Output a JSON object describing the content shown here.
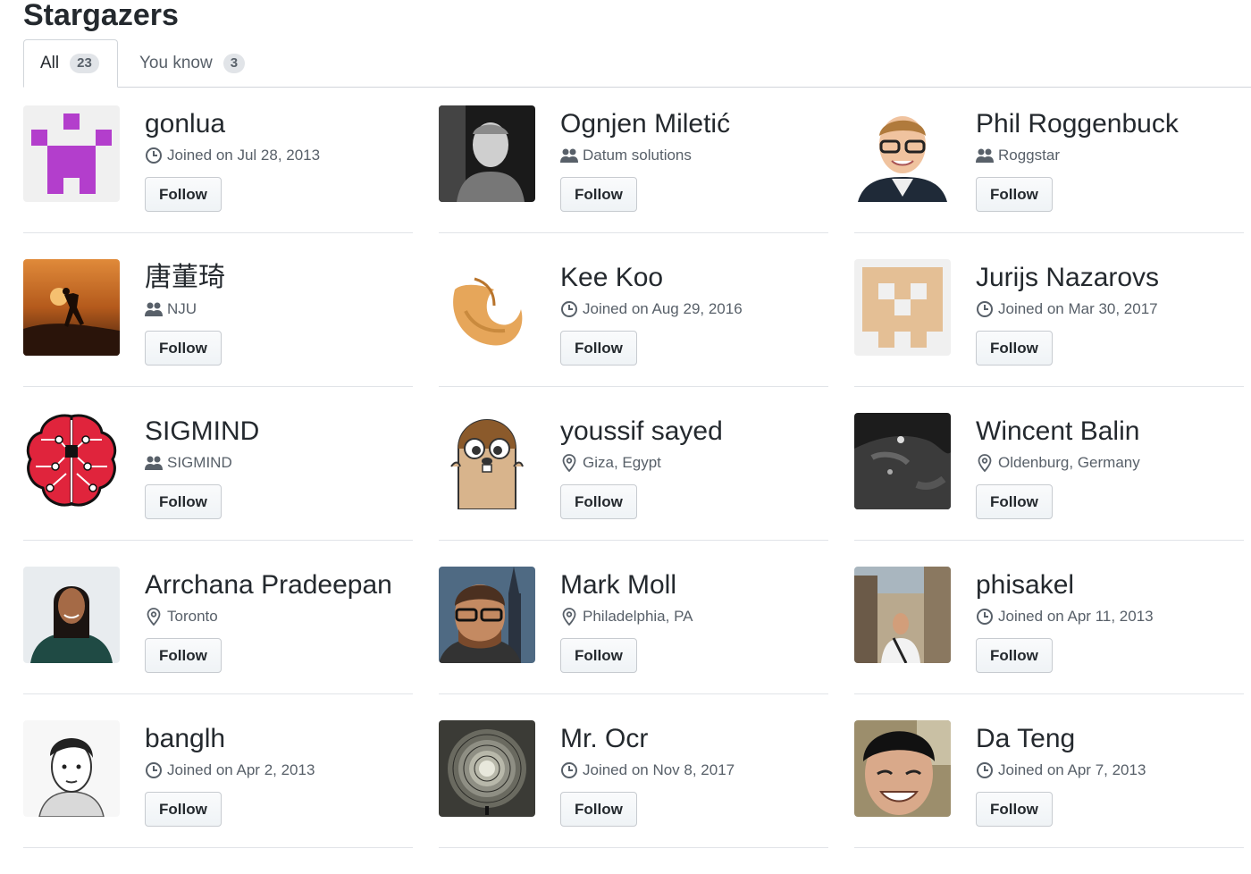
{
  "page": {
    "title": "Stargazers"
  },
  "tabs": [
    {
      "label": "All",
      "count": "23"
    },
    {
      "label": "You know",
      "count": "3"
    }
  ],
  "follow_label": "Follow",
  "users": [
    {
      "name": "gonlua",
      "meta": "Joined on Jul 28, 2013",
      "meta_icon": "clock-icon",
      "avatar": "identicon-purple"
    },
    {
      "name": "Ognjen Miletić",
      "meta": "Datum solutions",
      "meta_icon": "people-icon",
      "avatar": "photo-bw-man"
    },
    {
      "name": "Phil Roggenbuck",
      "meta": "Roggstar",
      "meta_icon": "people-icon",
      "avatar": "photo-man-glasses"
    },
    {
      "name": "唐董琦",
      "meta": "NJU",
      "meta_icon": "people-icon",
      "avatar": "photo-sunset"
    },
    {
      "name": "Kee Koo",
      "meta": "Joined on Aug 29, 2016",
      "meta_icon": "clock-icon",
      "avatar": "fortune-cookie"
    },
    {
      "name": "Jurijs Nazarovs",
      "meta": "Joined on Mar 30, 2017",
      "meta_icon": "clock-icon",
      "avatar": "identicon-tan"
    },
    {
      "name": "SIGMIND",
      "meta": "SIGMIND",
      "meta_icon": "people-icon",
      "avatar": "brain-logo"
    },
    {
      "name": "youssif sayed",
      "meta": "Giza, Egypt",
      "meta_icon": "location-icon",
      "avatar": "gopher"
    },
    {
      "name": "Wincent Balin",
      "meta": "Oldenburg, Germany",
      "meta_icon": "location-icon",
      "avatar": "photo-dark"
    },
    {
      "name": "Arrchana Pradeepan",
      "meta": "Toronto",
      "meta_icon": "location-icon",
      "avatar": "photo-woman"
    },
    {
      "name": "Mark Moll",
      "meta": "Philadelphia, PA",
      "meta_icon": "location-icon",
      "avatar": "photo-man-beard"
    },
    {
      "name": "phisakel",
      "meta": "Joined on Apr 11, 2013",
      "meta_icon": "clock-icon",
      "avatar": "photo-city"
    },
    {
      "name": "banglh",
      "meta": "Joined on Apr 2, 2013",
      "meta_icon": "clock-icon",
      "avatar": "photo-sketch"
    },
    {
      "name": "Mr. Ocr",
      "meta": "Joined on Nov 8, 2017",
      "meta_icon": "clock-icon",
      "avatar": "photo-engraving"
    },
    {
      "name": "Da Teng",
      "meta": "Joined on Apr 7, 2013",
      "meta_icon": "clock-icon",
      "avatar": "photo-smile"
    }
  ],
  "colors": {
    "border": "#e1e4e8",
    "text": "#24292e",
    "muted": "#586069",
    "identicon_purple": "#b33ecc",
    "identicon_tan": "#e4bf95"
  }
}
